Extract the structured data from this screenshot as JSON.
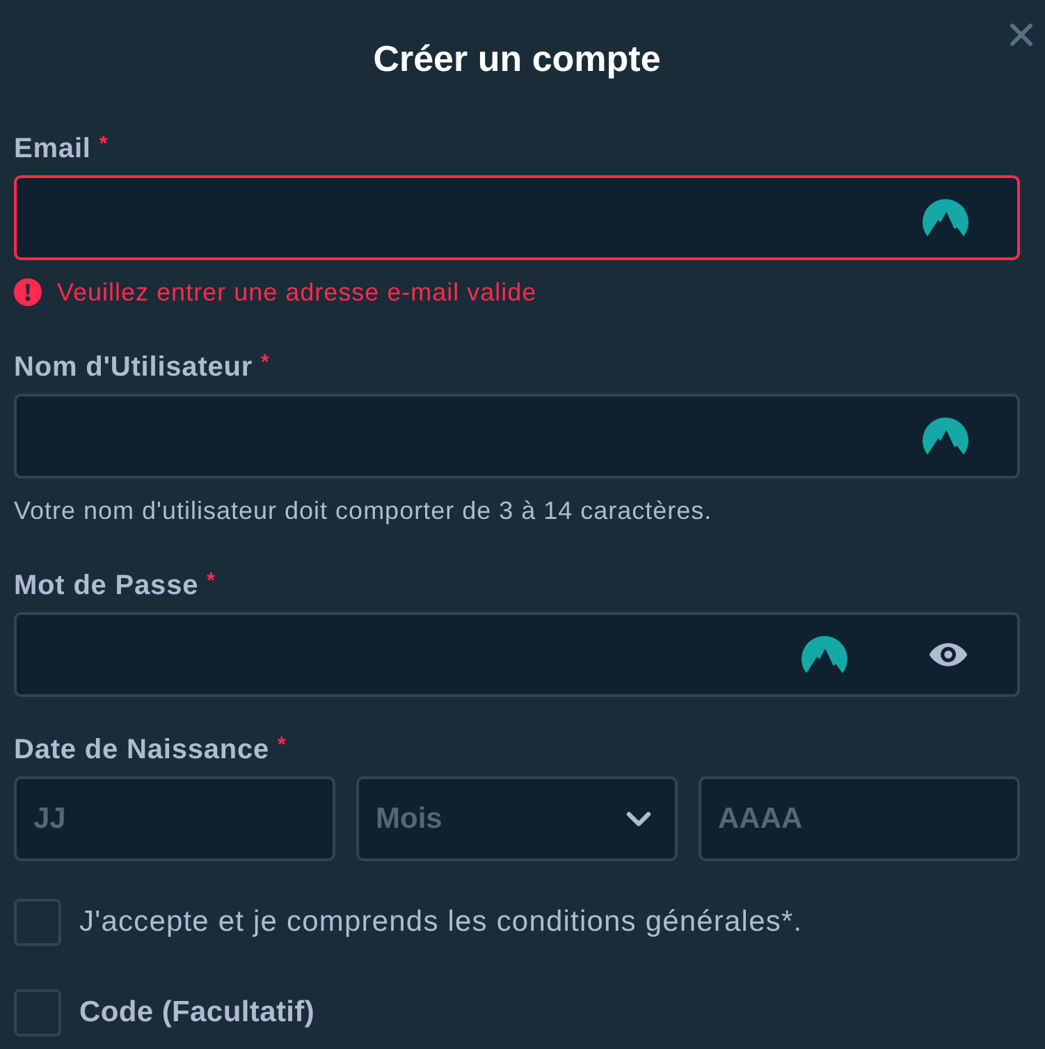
{
  "dialog": {
    "title": "Créer un compte"
  },
  "fields": [
    {
      "kind": "email",
      "label": "Email",
      "required_mark": "*",
      "invalid": true,
      "error": "Veuillez entrer une adresse e-mail valide"
    },
    {
      "kind": "username",
      "label": "Nom d'Utilisateur",
      "required_mark": "*",
      "invalid": false,
      "hint": "Votre nom d'utilisateur doit comporter de 3 à 14 caractères."
    },
    {
      "kind": "password",
      "label": "Mot de Passe",
      "required_mark": "*",
      "invalid": false
    },
    {
      "kind": "date",
      "label": "Date de Naissance",
      "required_mark": "*",
      "invalid": false,
      "parts": [
        {
          "kind": "day",
          "placeholder": "JJ"
        },
        {
          "kind": "month",
          "placeholder": "Mois"
        },
        {
          "kind": "year",
          "placeholder": "AAAA"
        }
      ]
    }
  ],
  "checkboxes": [
    {
      "kind": "consent",
      "label": "J'accepte et je comprends les conditions générales*.",
      "checked": false
    },
    {
      "kind": "optional",
      "label": "Code (Facultatif)",
      "checked": false
    }
  ]
}
